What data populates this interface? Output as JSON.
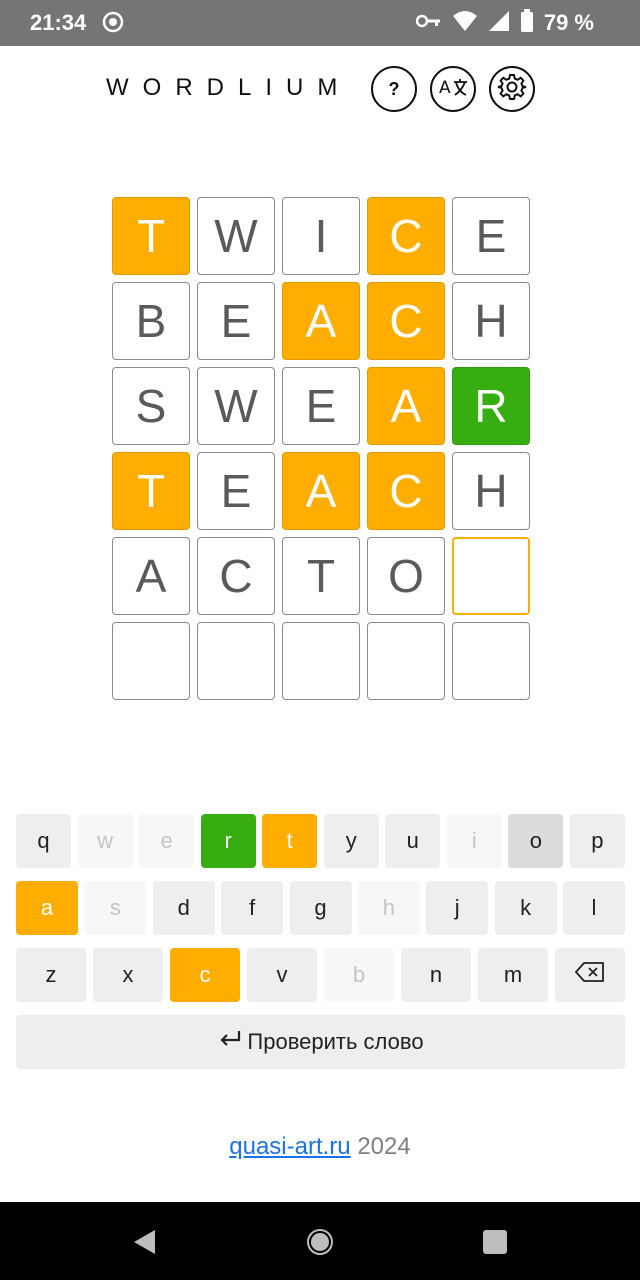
{
  "status_bar": {
    "time": "21:34",
    "battery_text": "79 %",
    "icons": [
      "app-notification-icon",
      "key-icon",
      "wifi-icon",
      "signal-icon",
      "battery-icon"
    ]
  },
  "header": {
    "title": "WORDLIUM",
    "help_label": "?",
    "lang_icon": "translate-icon",
    "settings_icon": "gear-icon"
  },
  "board": {
    "rows": [
      [
        {
          "letter": "T",
          "state": "present"
        },
        {
          "letter": "W",
          "state": "absent"
        },
        {
          "letter": "I",
          "state": "absent"
        },
        {
          "letter": "C",
          "state": "present"
        },
        {
          "letter": "E",
          "state": "absent"
        }
      ],
      [
        {
          "letter": "B",
          "state": "absent"
        },
        {
          "letter": "E",
          "state": "absent"
        },
        {
          "letter": "A",
          "state": "present"
        },
        {
          "letter": "C",
          "state": "present"
        },
        {
          "letter": "H",
          "state": "absent"
        }
      ],
      [
        {
          "letter": "S",
          "state": "absent"
        },
        {
          "letter": "W",
          "state": "absent"
        },
        {
          "letter": "E",
          "state": "absent"
        },
        {
          "letter": "A",
          "state": "present"
        },
        {
          "letter": "R",
          "state": "correct"
        }
      ],
      [
        {
          "letter": "T",
          "state": "present"
        },
        {
          "letter": "E",
          "state": "absent"
        },
        {
          "letter": "A",
          "state": "present"
        },
        {
          "letter": "C",
          "state": "present"
        },
        {
          "letter": "H",
          "state": "absent"
        }
      ],
      [
        {
          "letter": "A",
          "state": "entered"
        },
        {
          "letter": "C",
          "state": "entered"
        },
        {
          "letter": "T",
          "state": "entered"
        },
        {
          "letter": "O",
          "state": "entered"
        },
        {
          "letter": "",
          "state": "active"
        }
      ],
      [
        {
          "letter": "",
          "state": "empty"
        },
        {
          "letter": "",
          "state": "empty"
        },
        {
          "letter": "",
          "state": "empty"
        },
        {
          "letter": "",
          "state": "empty"
        },
        {
          "letter": "",
          "state": "empty"
        }
      ]
    ]
  },
  "keyboard": {
    "rows": [
      [
        {
          "key": "q",
          "state": "unused"
        },
        {
          "key": "w",
          "state": "absent"
        },
        {
          "key": "e",
          "state": "absent"
        },
        {
          "key": "r",
          "state": "correct"
        },
        {
          "key": "t",
          "state": "present"
        },
        {
          "key": "y",
          "state": "unused"
        },
        {
          "key": "u",
          "state": "unused"
        },
        {
          "key": "i",
          "state": "absent"
        },
        {
          "key": "o",
          "state": "pressed"
        },
        {
          "key": "p",
          "state": "unused"
        }
      ],
      [
        {
          "key": "a",
          "state": "present"
        },
        {
          "key": "s",
          "state": "absent"
        },
        {
          "key": "d",
          "state": "unused"
        },
        {
          "key": "f",
          "state": "unused"
        },
        {
          "key": "g",
          "state": "unused"
        },
        {
          "key": "h",
          "state": "absent"
        },
        {
          "key": "j",
          "state": "unused"
        },
        {
          "key": "k",
          "state": "unused"
        },
        {
          "key": "l",
          "state": "unused"
        }
      ],
      [
        {
          "key": "z",
          "state": "unused"
        },
        {
          "key": "x",
          "state": "unused"
        },
        {
          "key": "c",
          "state": "present"
        },
        {
          "key": "v",
          "state": "unused"
        },
        {
          "key": "b",
          "state": "absent"
        },
        {
          "key": "n",
          "state": "unused"
        },
        {
          "key": "m",
          "state": "unused"
        },
        {
          "key": "backspace",
          "state": "unused",
          "icon": "backspace-icon"
        }
      ]
    ],
    "submit_label": "Проверить слово",
    "submit_icon": "enter-arrow-icon"
  },
  "footer": {
    "link_text": "quasi-art.ru",
    "year": "2024"
  },
  "nav_bar": {
    "icons": [
      "back-triangle-icon",
      "home-circle-icon",
      "recents-square-icon"
    ]
  },
  "colors": {
    "present": "#ffae00",
    "correct": "#36ad10",
    "active_border": "#f3b106",
    "status_bar": "#757575"
  }
}
